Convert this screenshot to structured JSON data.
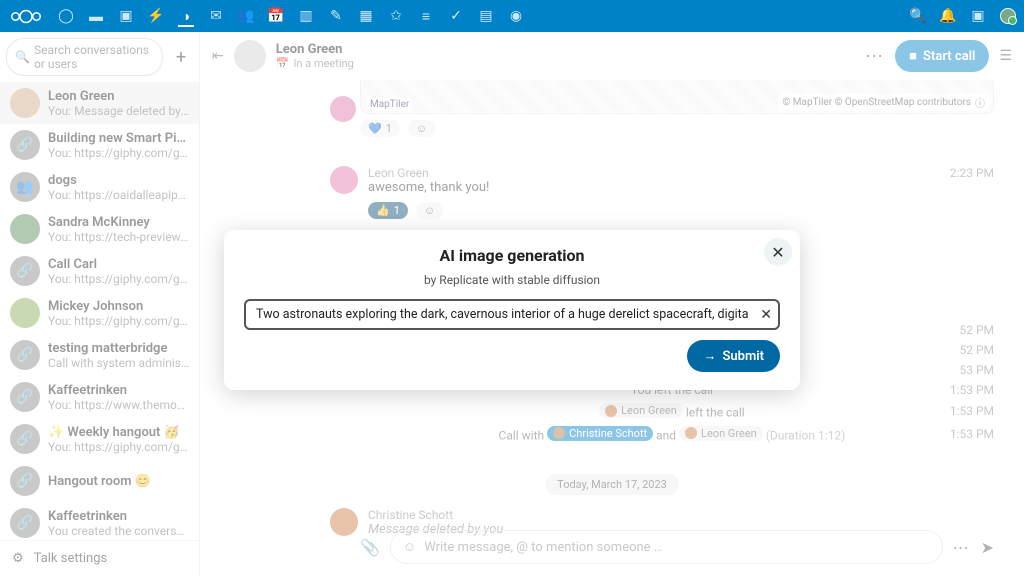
{
  "topbar": {
    "logo": "nextcloud-logo"
  },
  "sidebar": {
    "search_placeholder": "Search conversations or users",
    "items": [
      {
        "name": "Leon Green",
        "sub": "You: Message deleted by you"
      },
      {
        "name": "Building new Smart Pickers",
        "sub": "You: https://giphy.com/gifs/f…"
      },
      {
        "name": "dogs",
        "sub": "You: https://oaidalleapiprods…"
      },
      {
        "name": "Sandra McKinney",
        "sub": "You: https://tech-preview.ne…"
      },
      {
        "name": "Call Carl",
        "sub": "You: https://giphy.com/gifs/…"
      },
      {
        "name": "Mickey Johnson",
        "sub": "You: https://giphy.com/gifs/…"
      },
      {
        "name": "testing matterbridge",
        "sub": "Call with system administrat…"
      },
      {
        "name": "Kaffeetrinken",
        "sub": "You: https://www.themovied…"
      },
      {
        "name": "✨ Weekly hangout 🥳",
        "sub": "You: https://giphy.com/gifs/…"
      },
      {
        "name": "Hangout room 😊",
        "sub": ""
      },
      {
        "name": "Kaffeetrinken",
        "sub": "You created the conversation"
      }
    ],
    "footer": "Talk settings"
  },
  "chat": {
    "header": {
      "name": "Leon Green",
      "status_icon": "📅",
      "status": "In a meeting",
      "start_call": "Start call"
    },
    "map": {
      "brand": "MapTiler",
      "copy": "© MapTiler © OpenStreetMap contributors"
    },
    "react_love": {
      "emoji": "💙",
      "count": "1"
    },
    "msg1": {
      "author": "Leon Green",
      "text": "awesome, thank you!",
      "time": "2:23 PM",
      "react": {
        "emoji": "👍",
        "count": "1"
      }
    },
    "sys": [
      {
        "text": "",
        "time": "52 PM"
      },
      {
        "text": "",
        "time": "52 PM"
      },
      {
        "text": "",
        "time": "53 PM"
      },
      {
        "center": "You left the call",
        "time": "1:53 PM"
      },
      {
        "pill_name": "Leon Green",
        "after": "left the call",
        "time": "1:53 PM"
      },
      {
        "prefix": "Call with",
        "pill1": "Christine Schott",
        "mid": "and",
        "pill2": "Leon Green",
        "dur": "(Duration 1:12)",
        "time": "1:53 PM"
      }
    ],
    "date_chip": "Today, March 17, 2023",
    "msg2": {
      "author": "Christine Schott",
      "text": "Message deleted by you"
    },
    "composer_placeholder": "Write message, @ to mention someone …"
  },
  "modal": {
    "title": "AI image generation",
    "subtitle": "by Replicate with stable diffusion",
    "value": "Two astronauts exploring the dark, cavernous interior of a huge derelict spacecraft, digital art",
    "submit": "Submit"
  }
}
